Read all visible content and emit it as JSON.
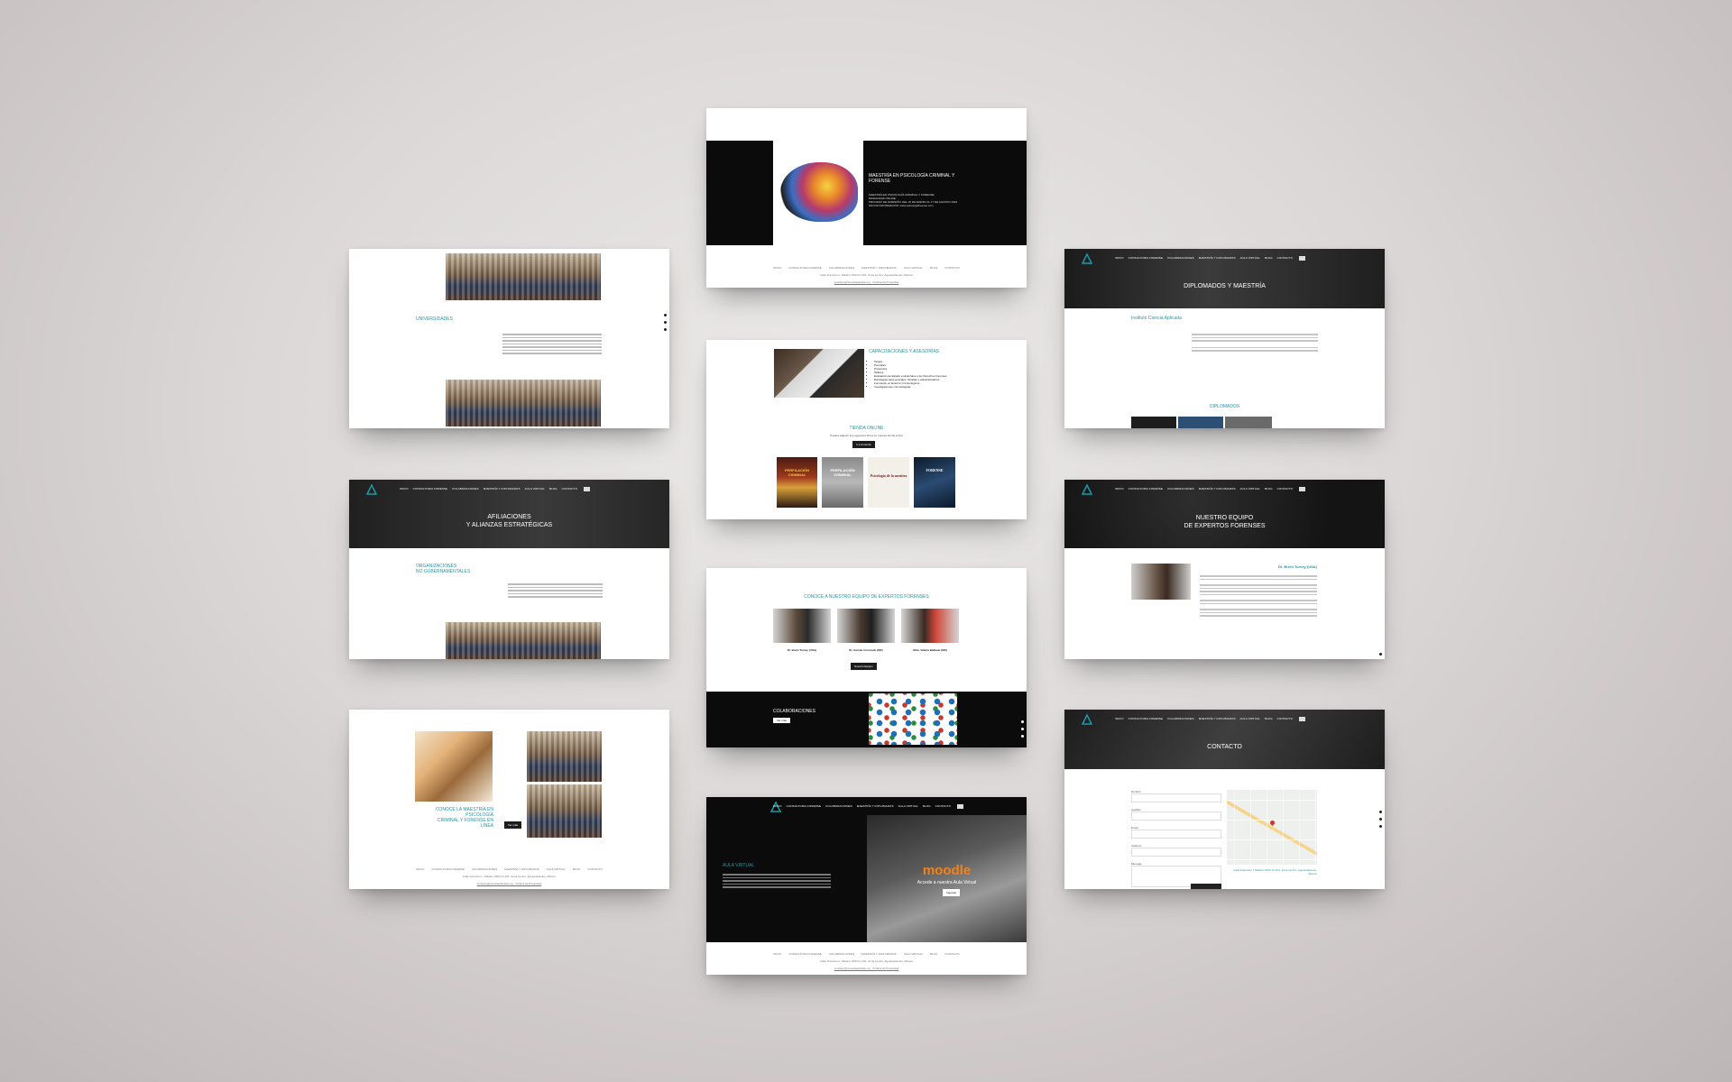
{
  "nav": [
    "INICIO",
    "CONSULTORIA FORENSE",
    "COLABORACIONES",
    "MAESTRÍA Y DIPLOMADOS",
    "AULA VIRTUAL",
    "BLOG",
    "CONTACTO"
  ],
  "footer_address": "Calle Francisco I. Madero #103 Int 201, Zona Centro, Aguascalientes, México",
  "footer_email": "contacto@cienciaaplicada.org · Política de Privacidad",
  "card_universidades": {
    "title": "UNIVERSIDADES"
  },
  "card_maestria": {
    "title": "MAESTRÍA EN PSICOLOGÍA CRIMINAL Y FORENSE",
    "lines": [
      "MAESTRÍA EN PSICOLOGÍA CRIMINAL Y FORENSE",
      "MODALIDAD ONLINE",
      "PROCESO DE ADMISIÓN: DEL 15 DE MARZO AL 17 DE AGOSTO 2024",
      "MAYOR INFORMACIÓN: www.psicologiaforense.com"
    ]
  },
  "card_diplomados": {
    "hero": "DIPLOMADOS Y MAESTRÍA",
    "subtitle": "Instituto Ciencia Aplicada",
    "section": "DIPLOMADOS"
  },
  "card_capacitaciones": {
    "title": "CAPACITACIONES Y ASESORÍAS",
    "items": [
      "Tarjeta",
      "Periciales",
      "Protocolos",
      "Talleres",
      "Evaluación de Estado e Historiales a los Derechos Forenses",
      "Estrategias para periciales, fiscalías y administradores",
      "Formación en Entorno Criminológicos",
      "Investigaciones criminológicas"
    ],
    "store_title": "TIENDA ONLINE",
    "store_text": "Puedes adquirir los siguientes libros en nuestra tienda online",
    "store_button": "Ir a la tienda",
    "books": [
      "PERFILACIÓN CRIMINAL",
      "PERFILACIÓN CRIMINAL",
      "Psicología de la mentira",
      "FORENSE"
    ]
  },
  "card_afiliaciones": {
    "hero_line1": "AFILIACIONES",
    "hero_line2": "Y ALIANZAS ESTRATÉGICAS",
    "section_line1": "ORGANIZACIONES",
    "section_line2": "NO GUBERNAMENTALES"
  },
  "card_equipo_home": {
    "title": "CONOCE A NUESTRO EQUIPO DE EXPERTOS FORENSES",
    "people": [
      "Dr. Brent Turvey (USA)",
      "Dr. Aurelio Coronado (MX)",
      "Mtra. Valeria Baltazar (MX)"
    ],
    "button": "Nuestro Equipo",
    "collab_title": "COLABORACIONES",
    "collab_button": "Ver más"
  },
  "card_equipo": {
    "hero_line1": "NUESTRO EQUIPO",
    "hero_line2": "DE EXPERTOS FORENSES",
    "name": "Dr. Brent Turvey (USA)"
  },
  "card_maestria_linea": {
    "title_line1": "CONOCE LA MAESTRÍA EN PSICOLOGÍA",
    "title_line2": "CRIMINAL Y FORENSE EN LÍNEA",
    "button": "Ver más"
  },
  "card_aula": {
    "title": "AULA VIRTUAL",
    "brand": "moodle",
    "subtitle": "Accede a nuestra Aula Virtual",
    "button": "Ingresar"
  },
  "card_contacto": {
    "hero": "CONTACTO",
    "fields": [
      "Nombre",
      "Apellido",
      "Email",
      "Teléfono",
      "Mensaje"
    ],
    "map_address": "Calle Francisco I. Madero #103 Int 201, Zona Centro, Aguascalientes, México"
  },
  "colors": {
    "teal": "#1a9aa8",
    "dark": "#0b0b0b",
    "moodle": "#f98012"
  }
}
